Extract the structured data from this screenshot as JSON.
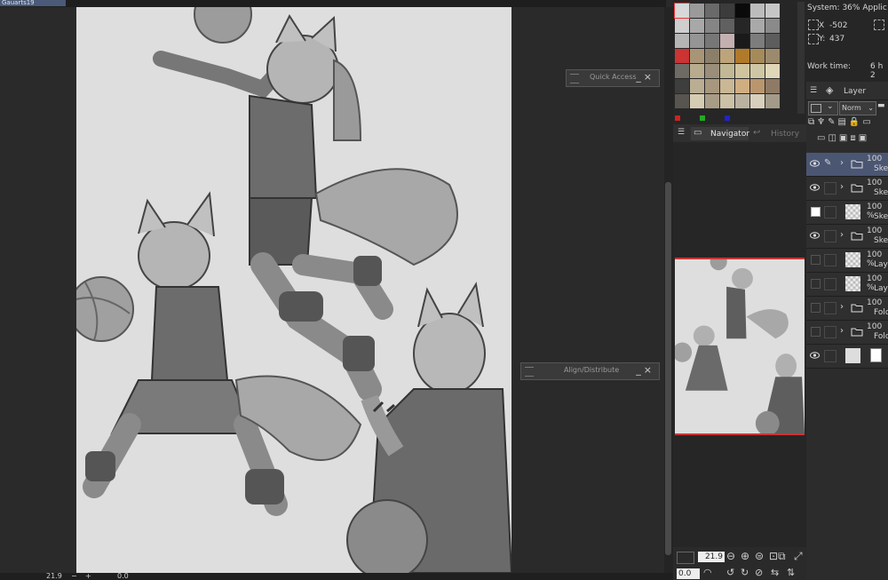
{
  "window": {
    "tab_label": "Gauarts19"
  },
  "palettes": {
    "quick_access": {
      "title": "Quick Access",
      "min": "_",
      "close": "×"
    },
    "align": {
      "title": "Align/Distribute",
      "min": "_",
      "close": "×"
    }
  },
  "info": {
    "system": "System: 36% Applic",
    "x_label": "X",
    "x_value": "-502",
    "y_label": "Y:",
    "y_value": "437",
    "work_time_label": "Work time:",
    "work_time_value": "6 h 2"
  },
  "layer_panel": {
    "tab": "Layer",
    "blend_mode": "Norm",
    "layers": [
      {
        "opacity": "100",
        "name": "Ske",
        "type": "folder",
        "visible": true,
        "selected": true
      },
      {
        "opacity": "100",
        "name": "Ske",
        "type": "folder",
        "visible": true,
        "selected": false
      },
      {
        "opacity": "100 %",
        "name": "Sketc",
        "type": "raster",
        "visible": false,
        "selected": false
      },
      {
        "opacity": "100",
        "name": "Ske",
        "type": "folder",
        "visible": true,
        "selected": false
      },
      {
        "opacity": "100 %",
        "name": "Layer",
        "type": "raster",
        "visible": false,
        "selected": false
      },
      {
        "opacity": "100 %",
        "name": "Layer",
        "type": "raster",
        "visible": false,
        "selected": false
      },
      {
        "opacity": "100",
        "name": "Fold",
        "type": "folder",
        "visible": false,
        "selected": false
      },
      {
        "opacity": "100",
        "name": "Fold",
        "type": "folder",
        "visible": false,
        "selected": false
      },
      {
        "opacity": "",
        "name": "",
        "type": "paper",
        "visible": true,
        "selected": false
      }
    ]
  },
  "navigator": {
    "tab_active": "Navigator",
    "tab_inactive": "History",
    "zoom": "21.9",
    "rotation": "0.0"
  },
  "status_bar": {
    "zoom": "21.9",
    "rotation": "0.0",
    "plus": "+",
    "minus": "−"
  },
  "colors": {
    "accent_selected": "#4b5673",
    "nav_frame": "#cc3333",
    "paper": "#dedede"
  },
  "color_swatches": [
    "#d8d8d8",
    "#9a9a9a",
    "#6a6a6a",
    "#3c3c3c",
    "#0a0a0a",
    "#bcbcbc",
    "#c6c6c6",
    "#cfcfcf",
    "#a8a8a8",
    "#858585",
    "#606060",
    "#262626",
    "#a9a9a9",
    "#8a8a8a",
    "#b5b5b5",
    "#959595",
    "#777777",
    "#c4b0b0",
    "#1a1a1a",
    "#7d7d7d",
    "#5d5d5d",
    "#cc3333",
    "#a89578",
    "#8c7f6a",
    "#bda47a",
    "#b07a2a",
    "#a58a5a",
    "#9c8a6e",
    "#6e6a64",
    "#b8ab8e",
    "#9a8e7a",
    "#c2b896",
    "#d0c49e",
    "#cfc7a4",
    "#e0d6b8",
    "#3e3e3e",
    "#b9ae94",
    "#a7977e",
    "#c9b795",
    "#cfae82",
    "#b9966e",
    "#8f7a66",
    "#585450",
    "#d6ccb4",
    "#a89c86",
    "#ccc0a6",
    "#b9b2a0",
    "#d8cfbc",
    "#a39a8a"
  ]
}
